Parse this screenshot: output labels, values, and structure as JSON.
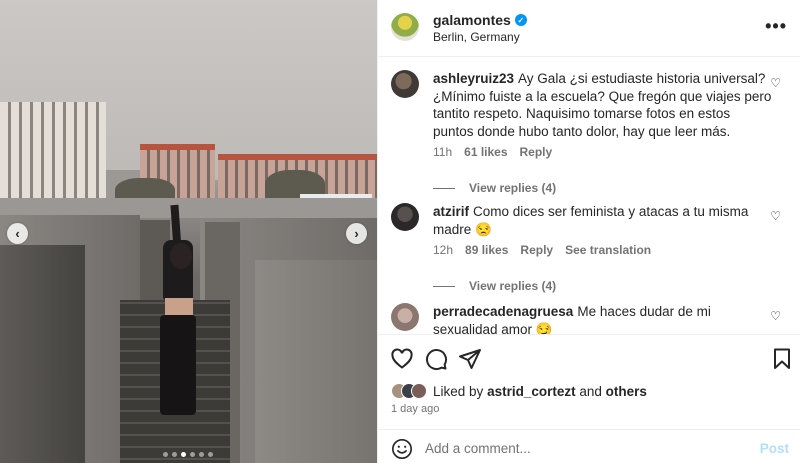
{
  "photo": {
    "prev_arrow": "‹",
    "next_arrow": "›",
    "carousel_dots": 6,
    "active_dot": 2
  },
  "header": {
    "username": "galamontes",
    "verified": true,
    "location": "Berlin, Germany",
    "more_icon": "more-icon"
  },
  "comments": [
    {
      "username": "ashleyruiz23",
      "text": "Ay Gala ¿si estudiaste historia universal? ¿Mínimo fuiste a la escuela? Que fregón que viajes pero tantito respeto. Naquisimo tomarse fotos en estos puntos donde hubo tanto dolor, hay que leer más.",
      "time": "11h",
      "likes": "61 likes",
      "reply": "Reply",
      "view_replies": "View replies (4)"
    },
    {
      "username": "atzirif",
      "text": "Como dices ser feminista y atacas a tu misma madre 😒",
      "time": "12h",
      "likes": "89 likes",
      "reply": "Reply",
      "translation": "See translation",
      "view_replies": "View replies (4)"
    },
    {
      "username": "perradecadenagruesa",
      "text": "Me haces dudar de mi sexualidad amor 😏"
    }
  ],
  "actions": {
    "liked_by_prefix": "Liked by",
    "liked_by_user": "astrid_cortezt",
    "liked_by_and": "and",
    "liked_by_others": "others",
    "time_ago": "1 day ago"
  },
  "add_comment": {
    "placeholder": "Add a comment...",
    "post_label": "Post"
  },
  "colors": {
    "link": "#0095f6",
    "post_disabled": "#b2dffc",
    "muted": "#737373"
  }
}
